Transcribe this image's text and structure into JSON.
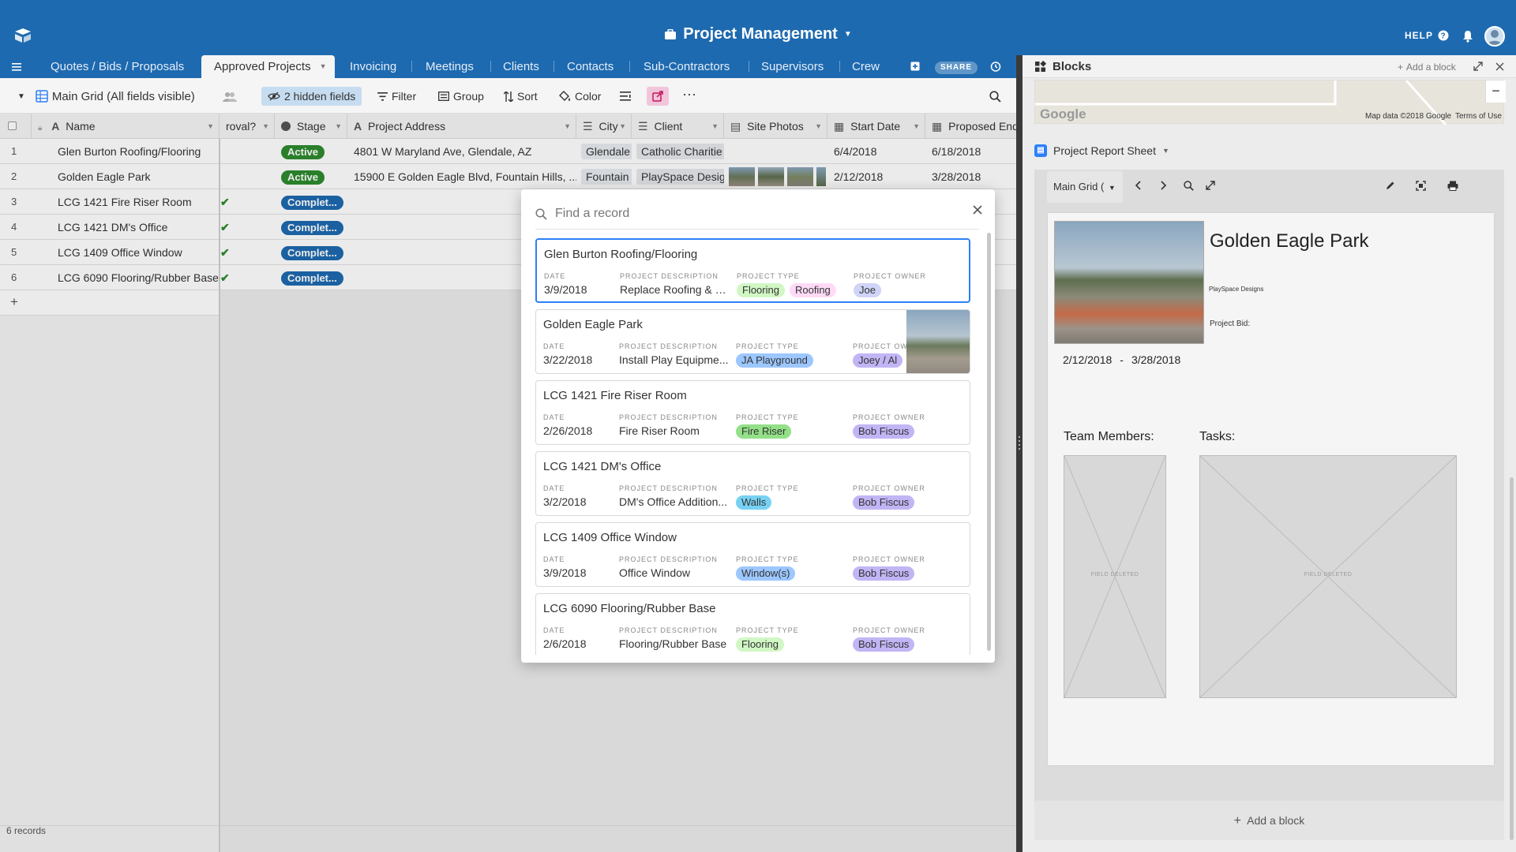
{
  "app": {
    "title": "Project Management",
    "help_label": "HELP"
  },
  "tabs": [
    {
      "label": "Quotes / Bids / Proposals"
    },
    {
      "label": "Approved Projects"
    },
    {
      "label": "Invoicing"
    },
    {
      "label": "Meetings"
    },
    {
      "label": "Clients"
    },
    {
      "label": "Contacts"
    },
    {
      "label": "Sub-Contractors"
    },
    {
      "label": "Supervisors"
    },
    {
      "label": "Crew"
    }
  ],
  "share_label": "SHARE",
  "toolbar": {
    "view_name": "Main Grid (All fields visible)",
    "hidden_fields": "2 hidden fields",
    "filter": "Filter",
    "group": "Group",
    "sort": "Sort",
    "color": "Color"
  },
  "columns": {
    "name": "Name",
    "approval": "roval?",
    "stage": "Stage",
    "address": "Project Address",
    "city": "City",
    "client": "Client",
    "photos": "Site Photos",
    "start": "Start Date",
    "end": "Proposed End"
  },
  "rows": [
    {
      "n": "1",
      "name": "Glen Burton Roofing/Flooring",
      "stage": "Active",
      "address": "4801 W Maryland Ave, Glendale, AZ",
      "city": "Glendale",
      "client": "Catholic Charitie",
      "start": "6/4/2018",
      "end": "6/18/2018"
    },
    {
      "n": "2",
      "name": "Golden Eagle Park",
      "stage": "Active",
      "address": "15900 E Golden Eagle Blvd, Fountain Hills, ...",
      "city": "Fountain H",
      "client": "PlaySpace Desig",
      "start": "2/12/2018",
      "end": "3/28/2018"
    },
    {
      "n": "3",
      "name": "LCG 1421 Fire Riser Room",
      "stage": "Complet...",
      "check": "✔"
    },
    {
      "n": "4",
      "name": "LCG 1421 DM's Office",
      "stage": "Complet...",
      "check": "✔"
    },
    {
      "n": "5",
      "name": "LCG 1409 Office Window",
      "stage": "Complet...",
      "check": "✔"
    },
    {
      "n": "6",
      "name": "LCG 6090 Flooring/Rubber Base",
      "stage": "Complet...",
      "check": "✔"
    }
  ],
  "add_row": "+",
  "record_count": "6 records",
  "modal": {
    "placeholder": "Find a record",
    "labels": {
      "date": "DATE",
      "desc": "PROJECT DESCRIPTION",
      "type": "PROJECT TYPE",
      "owner": "PROJECT OWNER"
    },
    "cards": [
      {
        "title": "Glen Burton Roofing/Flooring",
        "date": "3/9/2018",
        "desc": "Replace Roofing & Fl...",
        "types": [
          "Flooring",
          "Roofing"
        ],
        "owner": "Joe"
      },
      {
        "title": "Golden Eagle Park",
        "date": "3/22/2018",
        "desc": "Install Play Equipme...",
        "types": [
          "JA Playground"
        ],
        "owner": "Joey / Al"
      },
      {
        "title": "LCG 1421 Fire Riser Room",
        "date": "2/26/2018",
        "desc": "Fire Riser Room",
        "types": [
          "Fire Riser"
        ],
        "owner": "Bob Fiscus"
      },
      {
        "title": "LCG 1421 DM's Office",
        "date": "3/2/2018",
        "desc": "DM's Office Addition...",
        "types": [
          "Walls"
        ],
        "owner": "Bob Fiscus"
      },
      {
        "title": "LCG 1409 Office Window",
        "date": "3/9/2018",
        "desc": "Office Window",
        "types": [
          "Window(s)"
        ],
        "owner": "Bob Fiscus"
      },
      {
        "title": "LCG 6090 Flooring/Rubber Base",
        "date": "2/6/2018",
        "desc": "Flooring/Rubber Base",
        "types": [
          "Flooring"
        ],
        "owner": "Bob Fiscus"
      }
    ]
  },
  "blocks": {
    "title": "Blocks",
    "add_block": "Add a block",
    "map_logo": "Google",
    "map_credit": "Map data ©2018 Google",
    "map_terms": "Terms of Use",
    "report_name": "Project Report Sheet",
    "view_select": "Main Grid (",
    "page": {
      "title": "Golden Eagle Park",
      "client": "PlaySpace Designs",
      "bid": "Project Bid:",
      "start": "2/12/2018",
      "sep": "-",
      "end": "3/28/2018",
      "team": "Team Members:",
      "tasks": "Tasks:",
      "deleted": "FIELD DELETED"
    },
    "add_block_bottom": "Add a block"
  },
  "colors": {
    "brand": "#1e6ab0",
    "active_stage": "#2e8a2e",
    "complete_stage": "#1e6ab0",
    "selected": "#2d7ff9"
  }
}
